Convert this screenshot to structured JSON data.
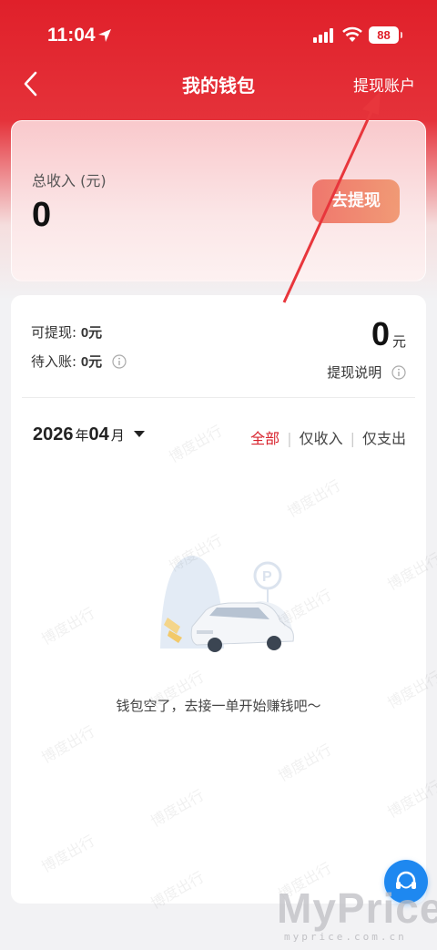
{
  "status_bar": {
    "time": "11:04",
    "battery": "88"
  },
  "nav": {
    "title": "我的钱包",
    "right_link": "提现账户"
  },
  "income_card": {
    "label": "总收入 (元)",
    "value": "0",
    "withdraw_button": "去提现"
  },
  "balance": {
    "withdrawable_label": "可提现: ",
    "withdrawable_value": "0元",
    "pending_label": "待入账: ",
    "pending_value": "0元",
    "amount": "0",
    "amount_unit": "元",
    "explain_link": "提现说明"
  },
  "filter": {
    "year": "2026",
    "year_suffix": "年",
    "month": "04",
    "month_suffix": "月",
    "tabs": [
      "全部",
      "仅收入",
      "仅支出"
    ],
    "active_tab": "全部"
  },
  "empty_state": {
    "text": "钱包空了，去接一单开始赚钱吧～"
  },
  "watermark_text": "博度出行",
  "site_mark": {
    "big": "MyPrice",
    "small": "myprice.com.cn"
  },
  "colors": {
    "brand_red": "#e0202a",
    "accent_orange": "#ee6c61",
    "fab_blue": "#1e88f0"
  }
}
